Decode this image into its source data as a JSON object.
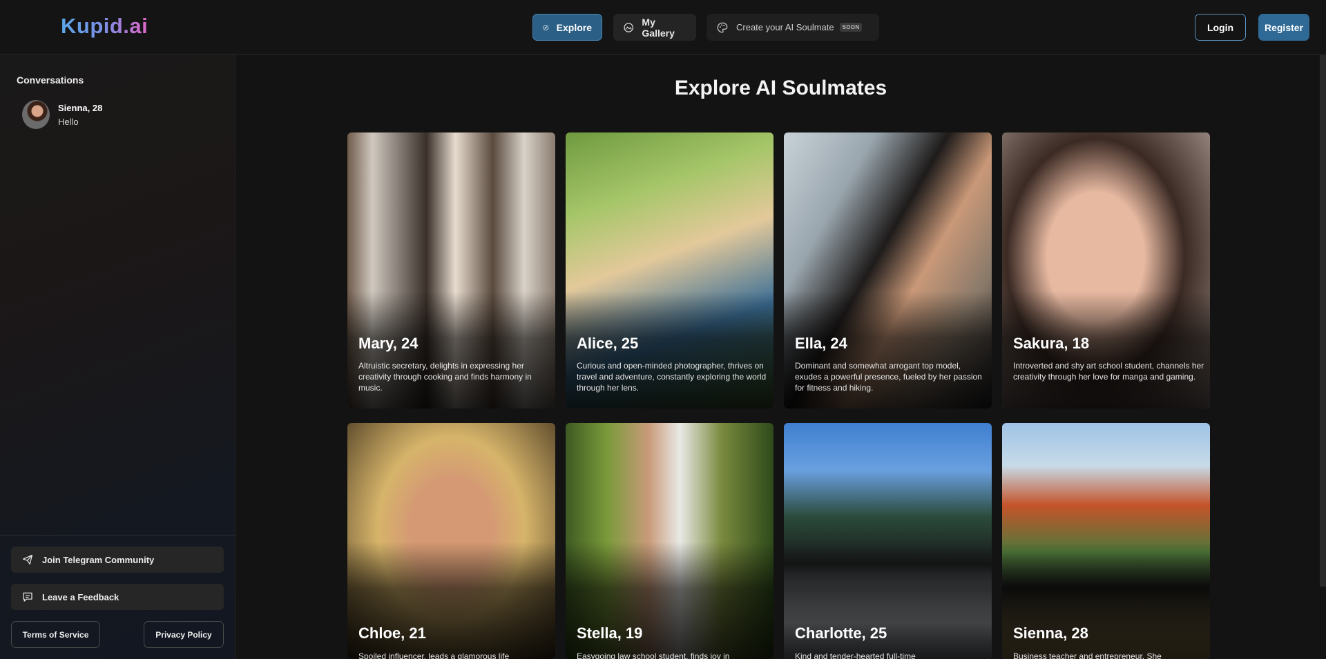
{
  "brand": {
    "logo_text": "Kupid.ai"
  },
  "nav": {
    "explore_label": "Explore",
    "gallery_label": "My Gallery",
    "create_label": "Create your AI Soulmate",
    "soon_badge": "SOON"
  },
  "auth": {
    "login_label": "Login",
    "register_label": "Register"
  },
  "sidebar": {
    "conversations_title": "Conversations",
    "conversations": [
      {
        "name": "Sienna, 28",
        "last_message": "Hello"
      }
    ],
    "telegram_label": "Join Telegram Community",
    "feedback_label": "Leave a Feedback",
    "tos_label": "Terms of Service",
    "privacy_label": "Privacy Policy"
  },
  "main": {
    "title": "Explore AI Soulmates",
    "cards": [
      {
        "name": "Mary, 24",
        "description": "Altruistic secretary, delights in expressing her creativity through cooking and finds harmony in music."
      },
      {
        "name": "Alice, 25",
        "description": "Curious and open-minded photographer, thrives on travel and adventure, constantly exploring the world through her lens."
      },
      {
        "name": "Ella, 24",
        "description": "Dominant and somewhat arrogant top model, exudes a powerful presence, fueled by her passion for fitness and hiking."
      },
      {
        "name": "Sakura, 18",
        "description": "Introverted and shy art school student, channels her creativity through her love for manga and gaming."
      },
      {
        "name": "Chloe, 21",
        "description": "Spoiled influencer, leads a glamorous life"
      },
      {
        "name": "Stella, 19",
        "description": "Easygoing law school student, finds joy in"
      },
      {
        "name": "Charlotte, 25",
        "description": "Kind and tender-hearted full-time"
      },
      {
        "name": "Sienna, 28",
        "description": "Business teacher and entrepreneur. She"
      }
    ]
  },
  "colors": {
    "accent": "#2b5f86",
    "background": "#131313",
    "register_button": "#2f6a96"
  }
}
